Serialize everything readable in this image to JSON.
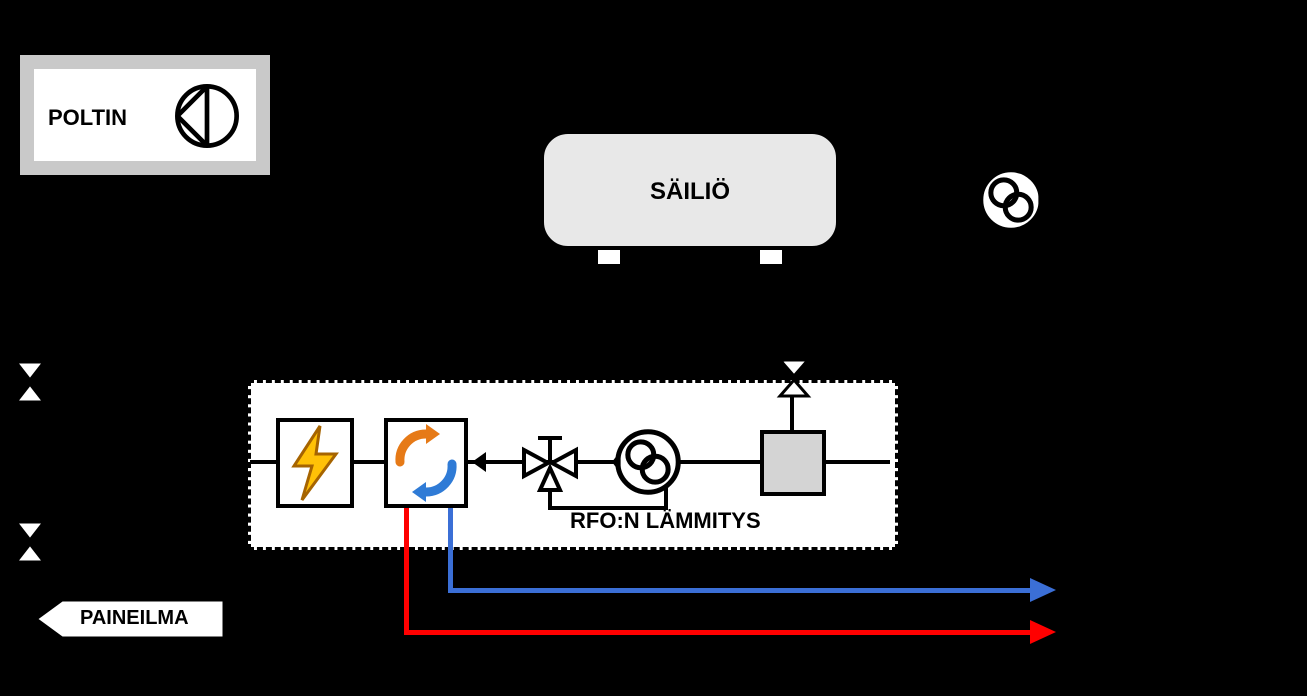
{
  "poltin": {
    "label": "POLTIN"
  },
  "tank": {
    "label": "SÄILIÖ"
  },
  "rfo": {
    "label": "RFO:N LÄMMITYS"
  },
  "paineilma": {
    "label": "PAINEILMA"
  },
  "icons": {
    "burner": "burner-icon",
    "pump": "pump-icon",
    "valve": "valve-icon",
    "heater_electric": "lightning-icon",
    "heat_exchanger": "cycle-arrows-icon",
    "filter": "filter-box-icon"
  },
  "colors": {
    "hot": "#ff0000",
    "cold": "#3b6fd6",
    "heater_orange": "#e67a17",
    "heater_blue": "#2f7bd6",
    "bolt_fill": "#ffc107",
    "bolt_stroke": "#a66400"
  }
}
